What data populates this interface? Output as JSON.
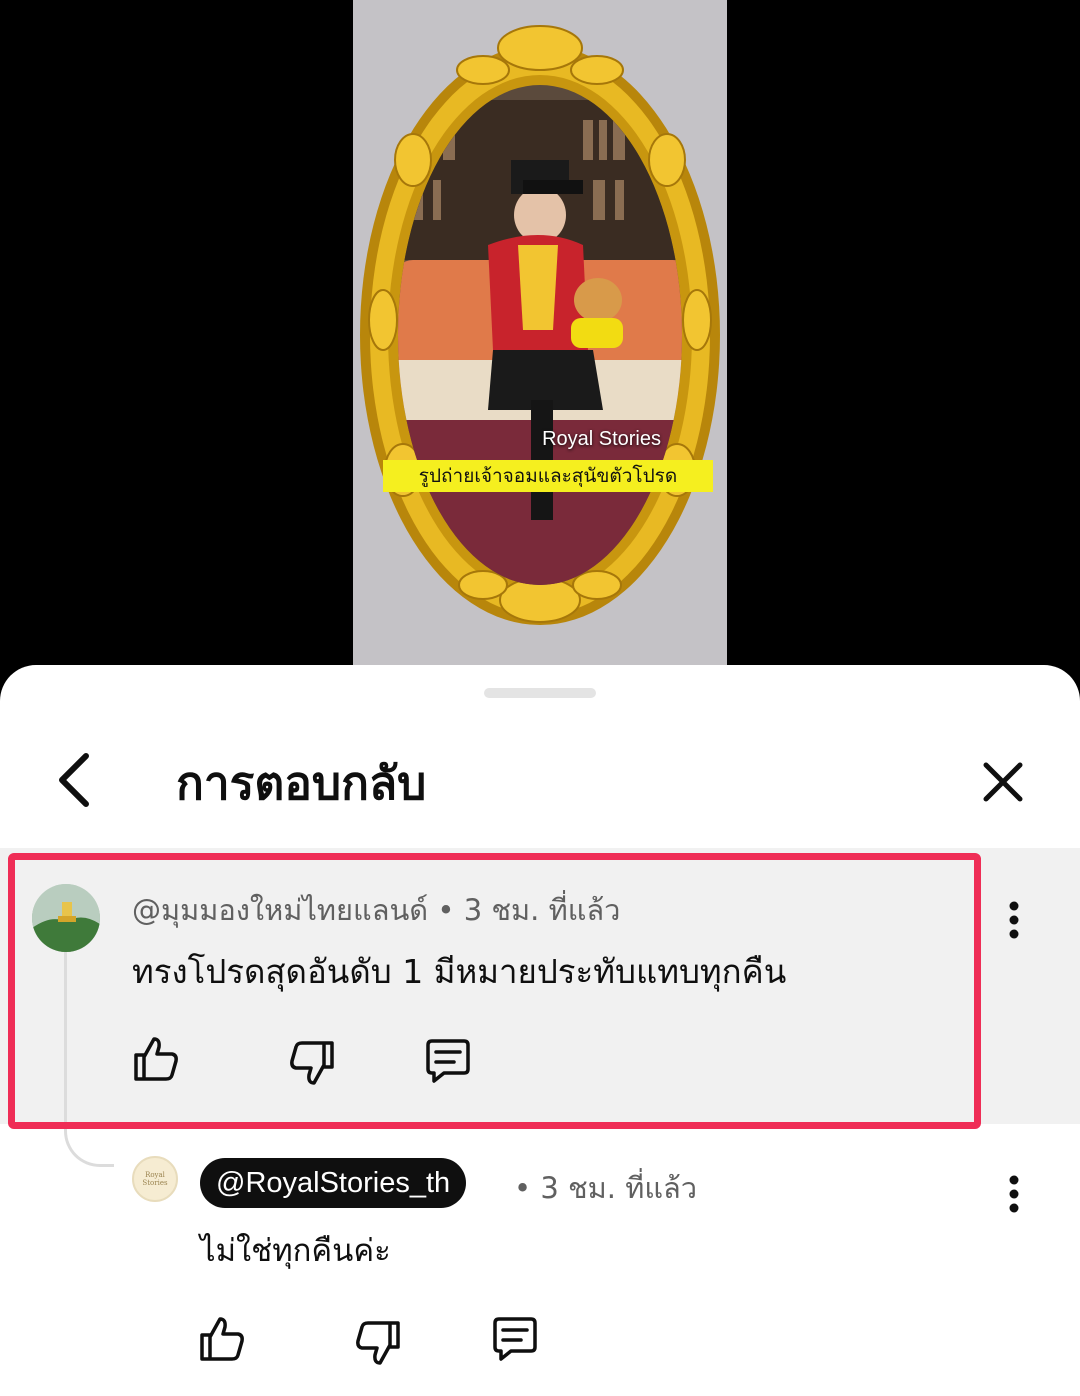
{
  "video": {
    "watermark": "Royal Stories",
    "caption": "รูปถ่ายเจ้าจอมและสุนัขตัวโปรด"
  },
  "sheet": {
    "title": "การตอบกลับ"
  },
  "comment": {
    "author": "@มุมมองใหม่ไทยแลนด์",
    "separator": "•",
    "time": "3 ชม. ที่แล้ว",
    "text": "ทรงโปรดสุดอันดับ 1 มีหมายประทับแทบทุกคืน",
    "highlight_color": "#ef2d56"
  },
  "reply": {
    "author": "@RoyalStories_th",
    "avatar_text": "Royal Stories",
    "separator": "•",
    "time": "3 ชม. ที่แล้ว",
    "text": "ไม่ใช่ทุกคืนค่ะ"
  },
  "icons": {
    "back": "chevron-left-icon",
    "close": "close-icon",
    "more": "more-vertical-icon",
    "like": "thumbs-up-icon",
    "dislike": "thumbs-down-icon",
    "reply": "comment-icon"
  }
}
